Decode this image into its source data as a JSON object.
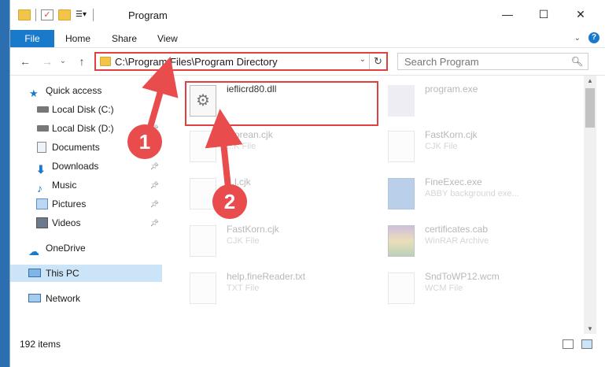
{
  "window": {
    "title": "Program"
  },
  "ribbon": {
    "tabs": [
      "File",
      "Home",
      "Share",
      "View"
    ]
  },
  "address": {
    "path": "C:\\Program Files\\Program Directory",
    "search_placeholder": "Search Program"
  },
  "sidebar": {
    "items": [
      {
        "label": "Quick access",
        "icon": "star-icon"
      },
      {
        "label": "Local Disk (C:)",
        "icon": "drive-icon"
      },
      {
        "label": "Local Disk (D:)",
        "icon": "drive-icon"
      },
      {
        "label": "Documents",
        "icon": "documents-icon"
      },
      {
        "label": "Downloads",
        "icon": "download-icon"
      },
      {
        "label": "Music",
        "icon": "music-icon"
      },
      {
        "label": "Pictures",
        "icon": "pictures-icon"
      },
      {
        "label": "Videos",
        "icon": "videos-icon"
      },
      {
        "label": "OneDrive",
        "icon": "cloud-icon"
      },
      {
        "label": "This PC",
        "icon": "computer-icon"
      },
      {
        "label": "Network",
        "icon": "network-icon"
      }
    ]
  },
  "files": [
    {
      "name": "ieflicrd80.dll",
      "type": ""
    },
    {
      "name": "program.exe",
      "type": ""
    },
    {
      "name": "...orean.cjk",
      "type": "...K File"
    },
    {
      "name": "FastKorn.cjk",
      "type": "CJK File"
    },
    {
      "name": "...l.cjk",
      "type": ""
    },
    {
      "name": "FineExec.exe",
      "type": "ABBY background exe..."
    },
    {
      "name": "FastKorn.cjk",
      "type": "CJK File"
    },
    {
      "name": "certificates.cab",
      "type": "WinRAR Archive"
    },
    {
      "name": "help.fineReader.txt",
      "type": "TXT File"
    },
    {
      "name": "SndToWP12.wcm",
      "type": "WCM File"
    }
  ],
  "status": {
    "count": "192 items"
  },
  "annotations": {
    "badge1": "1",
    "badge2": "2"
  },
  "colors": {
    "accent": "#1979ca",
    "highlight": "#e04040",
    "badge": "#e84c4c"
  }
}
